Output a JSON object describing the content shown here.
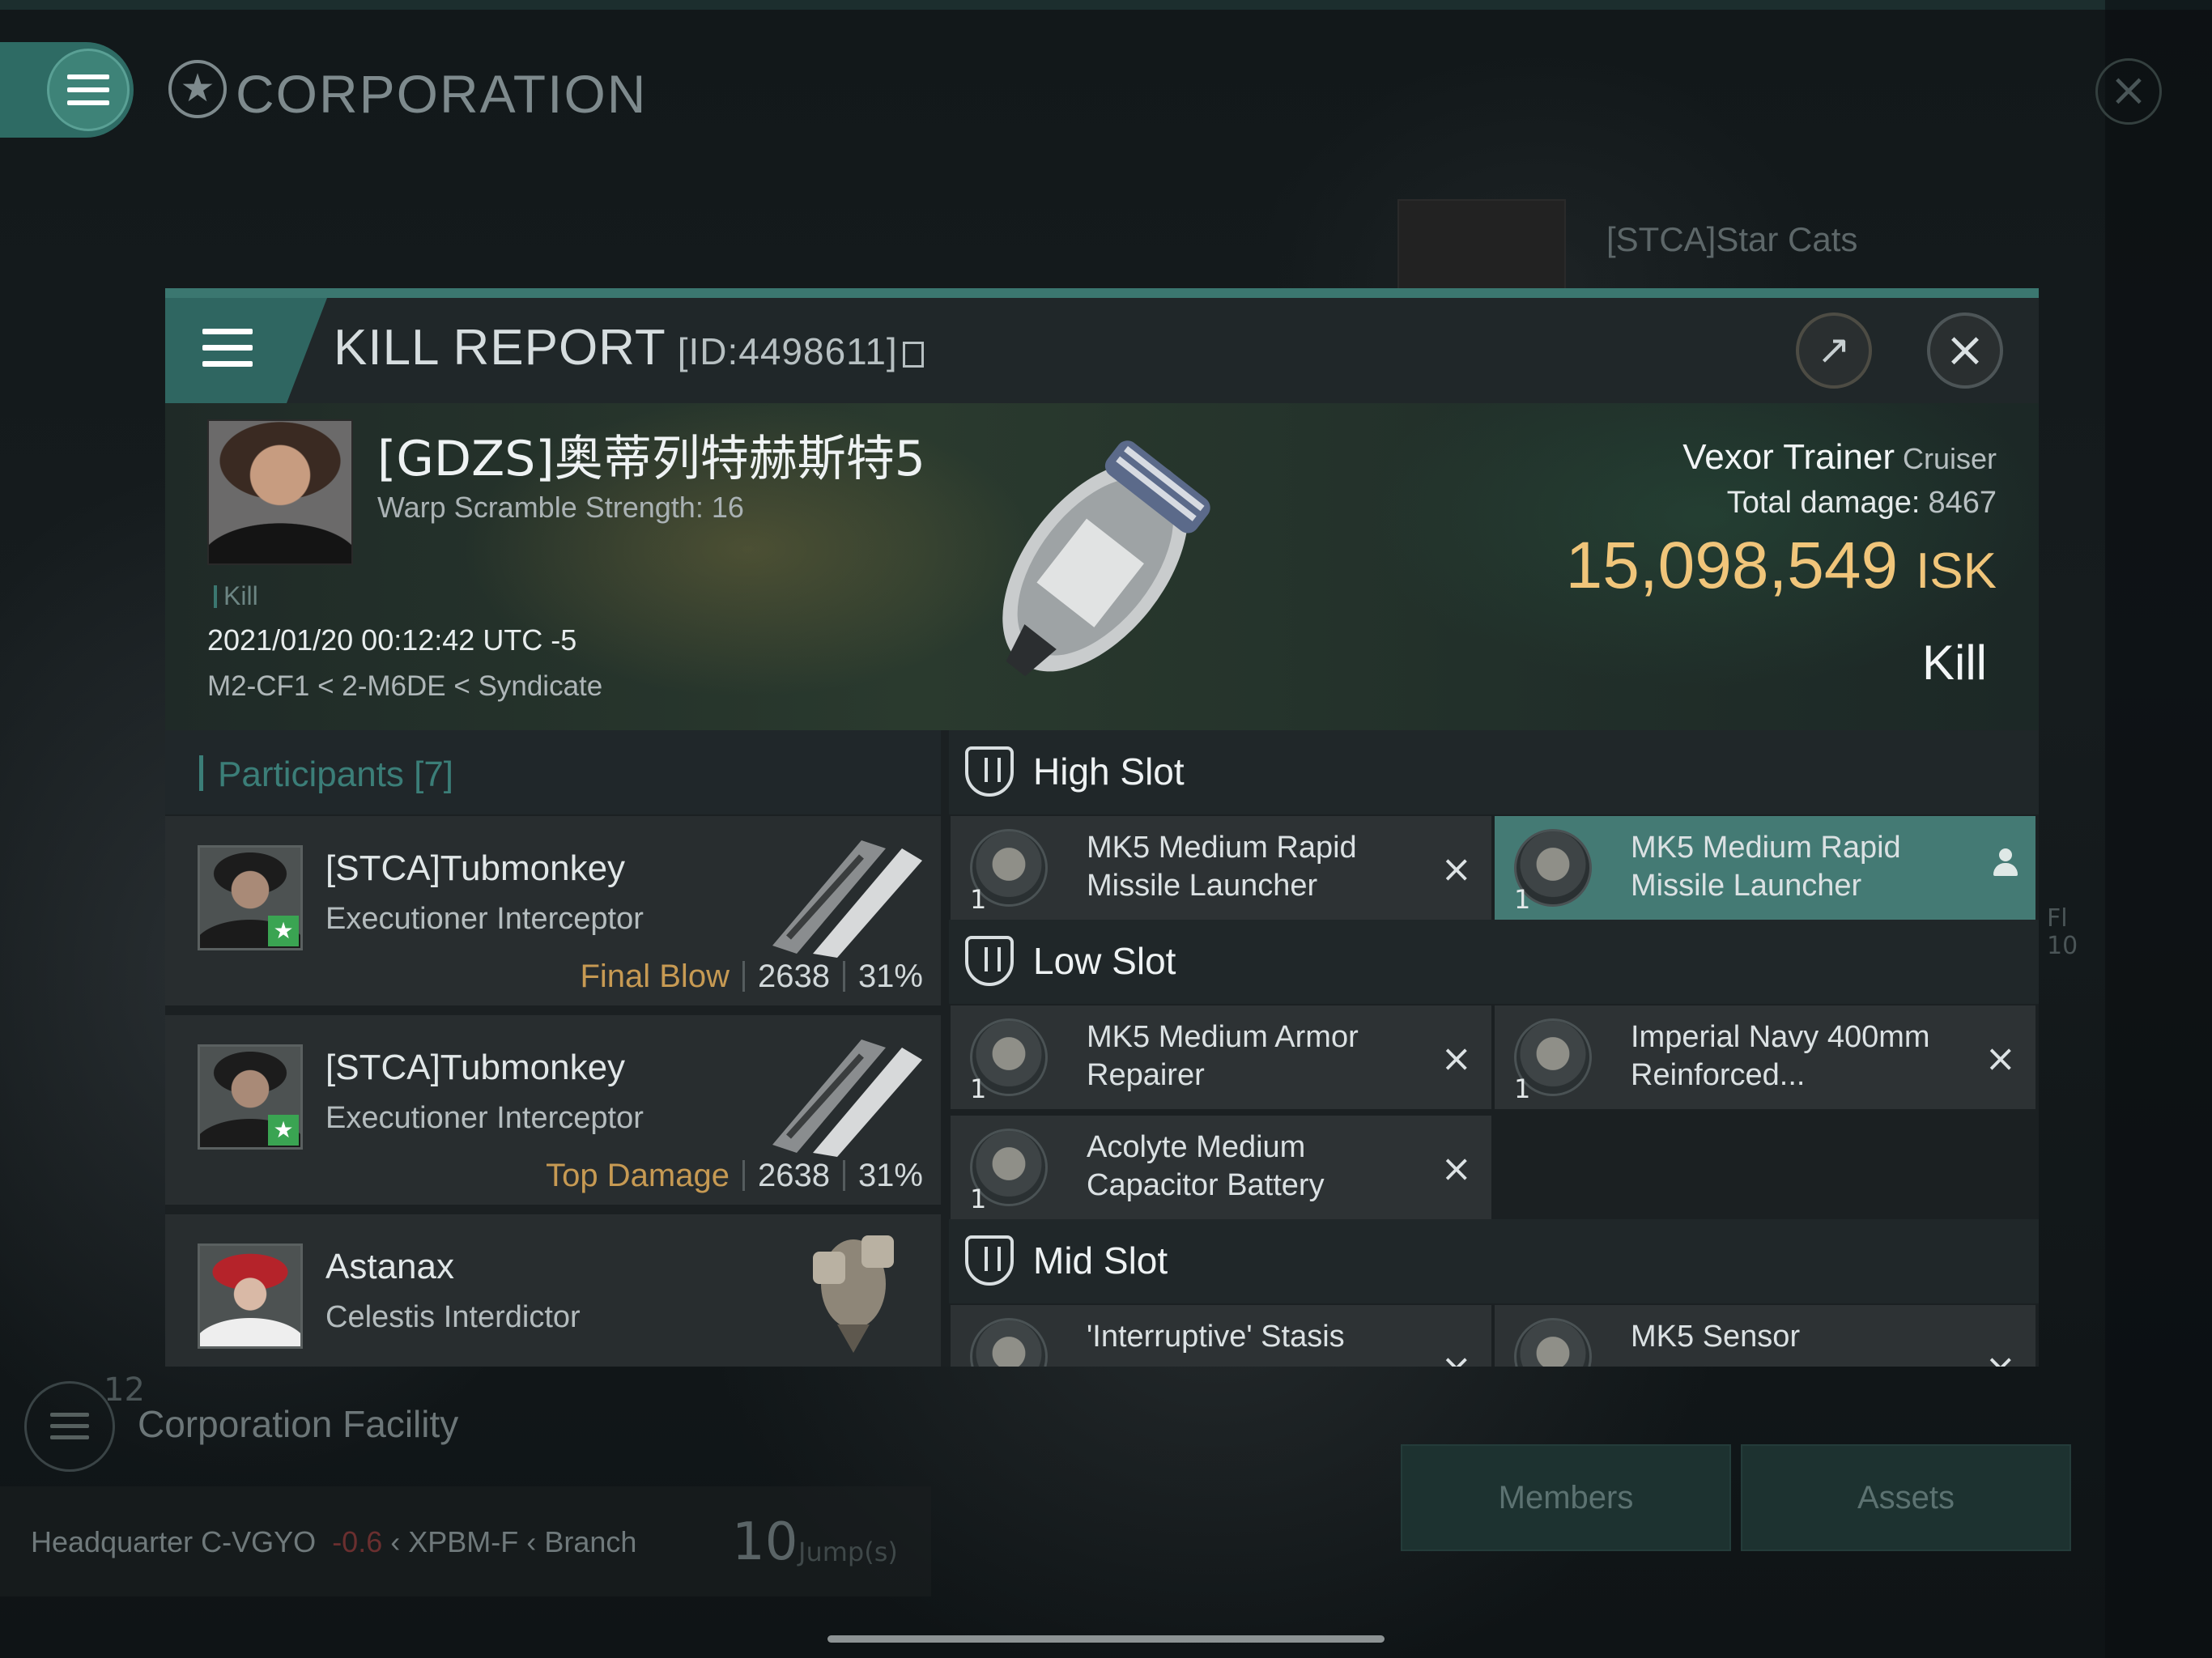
{
  "background": {
    "corp_title": "CORPORATION",
    "star_cats": "[STCA]Star Cats",
    "facility_count": "12",
    "facility_title": "Corporation Facility",
    "hq_label": "Headquarter",
    "hq_system": "C-VGYO",
    "hq_security": "-0.6",
    "hq_region": "XPBM-F",
    "hq_branch": "Branch",
    "jumps_value": "10",
    "jumps_label": "Jump(s)",
    "side_text_1": "Fl",
    "side_text_2": "10",
    "tab_members": "Members",
    "tab_assets": "Assets"
  },
  "modal": {
    "title": "KILL REPORT",
    "id": "[ID:4498611]",
    "victim": {
      "name": "[GDZS]奥蒂列特赫斯特5",
      "subtitle": "Warp Scramble Strength: 16",
      "tag": "Kill",
      "datetime": "2021/01/20 00:12:42 UTC -5",
      "location": "M2-CF1 < 2-M6DE < Syndicate"
    },
    "ship": {
      "name": "Vexor Trainer",
      "class": "Cruiser",
      "total_damage_label": "Total damage:",
      "total_damage": "8467",
      "isk_value": "15,098,549",
      "isk_unit": "ISK",
      "outcome": "Kill"
    },
    "participants": {
      "title": "Participants [7]",
      "items": [
        {
          "name": "[STCA]Tubmonkey",
          "ship": "Executioner Interceptor",
          "tag": "Final Blow",
          "damage": "2638",
          "percent": "31%"
        },
        {
          "name": "[STCA]Tubmonkey",
          "ship": "Executioner Interceptor",
          "tag": "Top Damage",
          "damage": "2638",
          "percent": "31%"
        },
        {
          "name": "Astanax",
          "ship": "Celestis Interdictor"
        }
      ]
    },
    "slots": {
      "high": {
        "label": "High Slot",
        "modules": [
          {
            "qty": "1",
            "name": "MK5 Medium Rapid Missile Launcher",
            "state": "destroyed"
          },
          {
            "qty": "1",
            "name": "MK5 Medium Rapid Missile Launcher",
            "state": "dropped"
          }
        ]
      },
      "low": {
        "label": "Low Slot",
        "modules": [
          {
            "qty": "1",
            "name": "MK5 Medium Armor Repairer",
            "state": "destroyed"
          },
          {
            "qty": "1",
            "name": "Imperial Navy 400mm Reinforced...",
            "state": "destroyed"
          },
          {
            "qty": "1",
            "name": "Acolyte Medium Capacitor Battery",
            "state": "destroyed"
          }
        ]
      },
      "mid": {
        "label": "Mid Slot",
        "modules": [
          {
            "name": "'Interruptive' Stasis"
          },
          {
            "name": "MK5 Sensor"
          }
        ]
      }
    },
    "icons": {
      "close": "×",
      "share": "↗",
      "star": "★"
    }
  }
}
